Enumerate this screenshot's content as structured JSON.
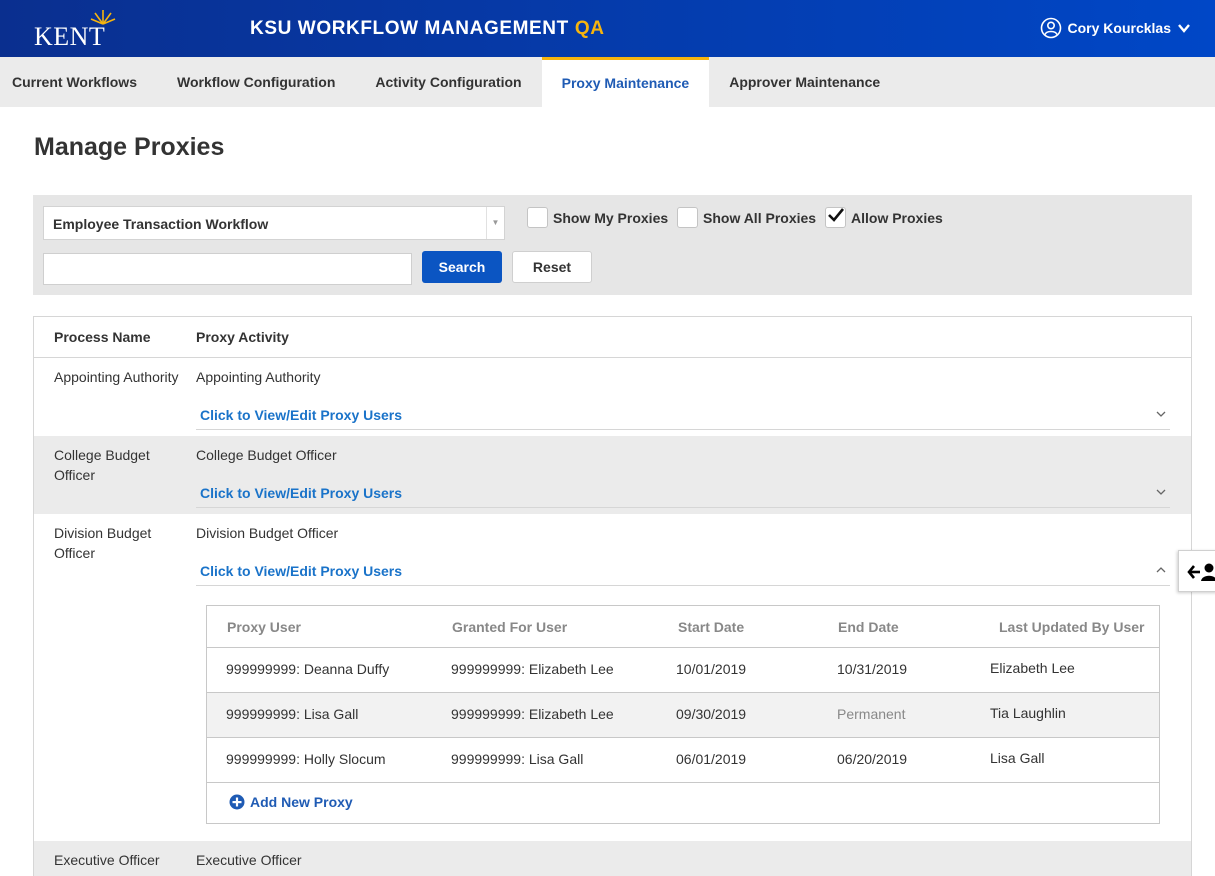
{
  "header": {
    "logo_text": "KENT STATE",
    "app_title": "KSU WORKFLOW MANAGEMENT",
    "env_label": "QA",
    "user_name": "Cory Kourcklas",
    "user_icon": "user-circle-icon",
    "menu_icon": "chevron-down-icon"
  },
  "tabs": [
    {
      "label": "Current Workflows",
      "active": false
    },
    {
      "label": "Workflow Configuration",
      "active": false
    },
    {
      "label": "Activity Configuration",
      "active": false
    },
    {
      "label": "Proxy Maintenance",
      "active": true
    },
    {
      "label": "Approver Maintenance",
      "active": false
    }
  ],
  "page": {
    "title": "Manage Proxies"
  },
  "filter": {
    "workflow_select": "Employee Transaction Workflow",
    "show_my_proxies": {
      "label": "Show My Proxies",
      "checked": false
    },
    "show_all_proxies": {
      "label": "Show All Proxies",
      "checked": false
    },
    "allow_proxies": {
      "label": "Allow Proxies",
      "checked": true
    },
    "search_value": "",
    "search_label": "Search",
    "reset_label": "Reset"
  },
  "table": {
    "headers": {
      "process": "Process Name",
      "activity": "Proxy Activity"
    },
    "expand_label": "Click to View/Edit Proxy Users",
    "rows": [
      {
        "process": "Appointing Authority",
        "activity": "Appointing Authority",
        "expanded": false
      },
      {
        "process": "College Budget Officer",
        "activity": "College Budget Officer",
        "expanded": false
      },
      {
        "process": "Division Budget Officer",
        "activity": "Division Budget Officer",
        "expanded": true
      },
      {
        "process": "Executive Officer",
        "activity": "Executive Officer",
        "expanded": false
      }
    ]
  },
  "proxy_table": {
    "headers": {
      "proxy_user": "Proxy User",
      "granted_for": "Granted For User",
      "start": "Start Date",
      "end": "End Date",
      "updated_by": "Last Updated By User"
    },
    "rows": [
      {
        "proxy_user": "999999999: Deanna Duffy",
        "granted_for": "999999999: Elizabeth Lee",
        "start": "10/01/2019",
        "end": "10/31/2019",
        "updated_by": "Elizabeth Lee"
      },
      {
        "proxy_user": "999999999: Lisa Gall",
        "granted_for": "999999999: Elizabeth Lee",
        "start": "09/30/2019",
        "end": "Permanent",
        "updated_by": "Tia Laughlin"
      },
      {
        "proxy_user": "999999999: Holly Slocum",
        "granted_for": "999999999: Lisa Gall",
        "start": "06/01/2019",
        "end": "06/20/2019",
        "updated_by": "Lisa Gall"
      }
    ],
    "add_label": "Add New Proxy"
  },
  "colors": {
    "brand_blue": "#0033a0",
    "accent_gold": "#f6b40e",
    "link_blue": "#1a73c9"
  }
}
